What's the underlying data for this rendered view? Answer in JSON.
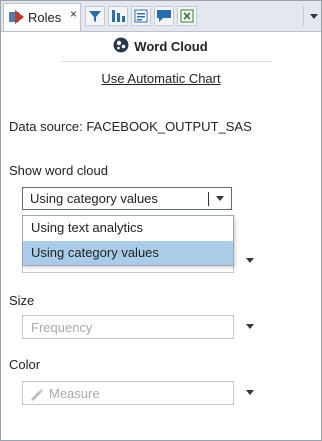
{
  "tab": {
    "title": "Roles",
    "close": "×"
  },
  "header": {
    "title": "Word Cloud",
    "auto_chart_link": "Use Automatic Chart"
  },
  "data_source": {
    "label": "Data source: FACEBOOK_OUTPUT_SAS"
  },
  "show_word_cloud": {
    "label": "Show word cloud",
    "selected": "Using category values",
    "options": [
      "Using text analytics",
      "Using category values"
    ]
  },
  "size": {
    "label": "Size",
    "placeholder": "Frequency"
  },
  "color": {
    "label": "Color",
    "placeholder": "Measure"
  },
  "colors": {
    "accent": "#aacce8",
    "tab_bg": "#e3e8ee"
  }
}
